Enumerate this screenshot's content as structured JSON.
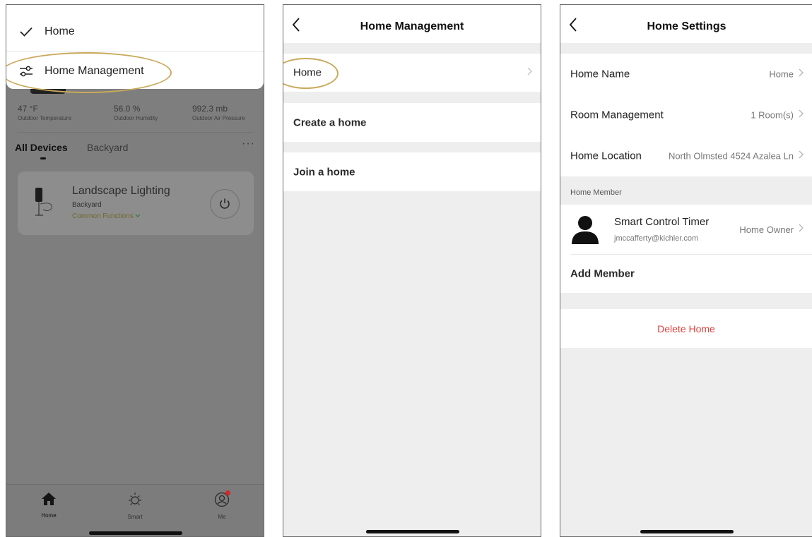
{
  "panel1": {
    "dropdown": {
      "items": [
        {
          "label": "Home",
          "icon": "checkmark-icon"
        },
        {
          "label": "Home Management",
          "icon": "sliders-icon"
        }
      ]
    },
    "weather": [
      {
        "value": "47 °F",
        "label": "Outdoor Temperature"
      },
      {
        "value": "56.0 %",
        "label": "Outdoor Humidity"
      },
      {
        "value": "992.3 mb",
        "label": "Outdoor Air Pressure"
      }
    ],
    "tabs": {
      "all": "All Devices",
      "room": "Backyard",
      "more": "···"
    },
    "device": {
      "name": "Landscape Lighting",
      "room": "Backyard",
      "functions": "Common Functions"
    },
    "nav": [
      {
        "label": "Home",
        "icon": "home-icon"
      },
      {
        "label": "Smart",
        "icon": "sun-icon"
      },
      {
        "label": "Me",
        "icon": "user-icon"
      }
    ]
  },
  "panel2": {
    "title": "Home Management",
    "items": [
      "Home",
      "Create a home",
      "Join a home"
    ]
  },
  "panel3": {
    "title": "Home Settings",
    "rows": [
      {
        "label": "Home Name",
        "value": "Home"
      },
      {
        "label": "Room Management",
        "value": "1 Room(s)"
      },
      {
        "label": "Home Location",
        "value": "North Olmsted 4524 Azalea Ln"
      }
    ],
    "member_section": "Home Member",
    "member": {
      "name": "Smart Control Timer",
      "email": "jmccafferty@kichler.com",
      "role": "Home Owner"
    },
    "add_member": "Add Member",
    "delete": "Delete Home"
  },
  "colors": {
    "accent_ellipse": "#c9a95c",
    "delete_red": "#e0443e",
    "overlay_gray": "#7e7e7e"
  }
}
